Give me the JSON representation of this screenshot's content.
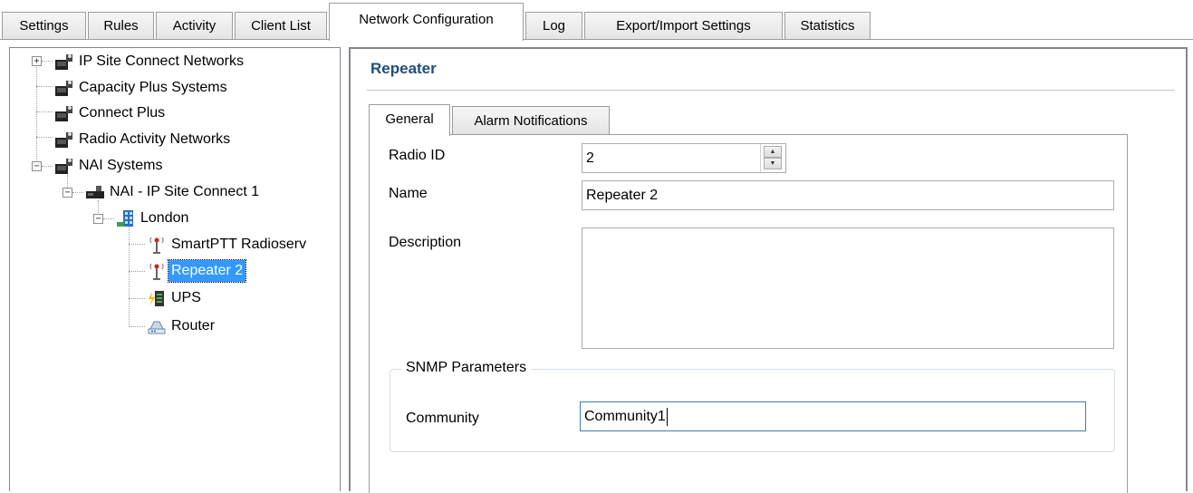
{
  "tabs": [
    {
      "label": "Settings"
    },
    {
      "label": "Rules"
    },
    {
      "label": "Activity"
    },
    {
      "label": "Client List"
    },
    {
      "label": "Network Configuration"
    },
    {
      "label": "Log"
    },
    {
      "label": "Export/Import Settings"
    },
    {
      "label": "Statistics"
    }
  ],
  "active_tab": "Network Configuration",
  "tree": {
    "nodes": [
      {
        "label": "IP Site Connect Networks",
        "icon": "network-group-icon",
        "expander": "+"
      },
      {
        "label": "Capacity Plus Systems",
        "icon": "network-group-icon"
      },
      {
        "label": "Connect Plus",
        "icon": "network-group-icon"
      },
      {
        "label": "Radio Activity Networks",
        "icon": "network-group-icon"
      },
      {
        "label": "NAI Systems",
        "icon": "network-group-icon",
        "expander": "−"
      },
      {
        "label": "NAI - IP Site Connect 1",
        "icon": "network-icon",
        "expander": "−"
      },
      {
        "label": "London",
        "icon": "building-icon",
        "expander": "−"
      },
      {
        "label": "SmartPTT Radioserv",
        "icon": "antenna-icon"
      },
      {
        "label": "Repeater 2",
        "icon": "antenna-icon",
        "selected": true
      },
      {
        "label": "UPS",
        "icon": "ups-battery-icon"
      },
      {
        "label": "Router",
        "icon": "router-icon"
      }
    ]
  },
  "detail": {
    "title": "Repeater",
    "subtabs": [
      {
        "label": "General"
      },
      {
        "label": "Alarm Notifications"
      }
    ],
    "active_subtab": "General",
    "fields": {
      "radio_id_label": "Radio ID",
      "radio_id_value": "2",
      "name_label": "Name",
      "name_value": "Repeater 2",
      "description_label": "Description",
      "description_value": ""
    },
    "snmp": {
      "group_label": "SNMP Parameters",
      "community_label": "Community",
      "community_value": "Community1"
    }
  },
  "colors": {
    "selection": "#3399ff",
    "title": "#1f4e79"
  }
}
